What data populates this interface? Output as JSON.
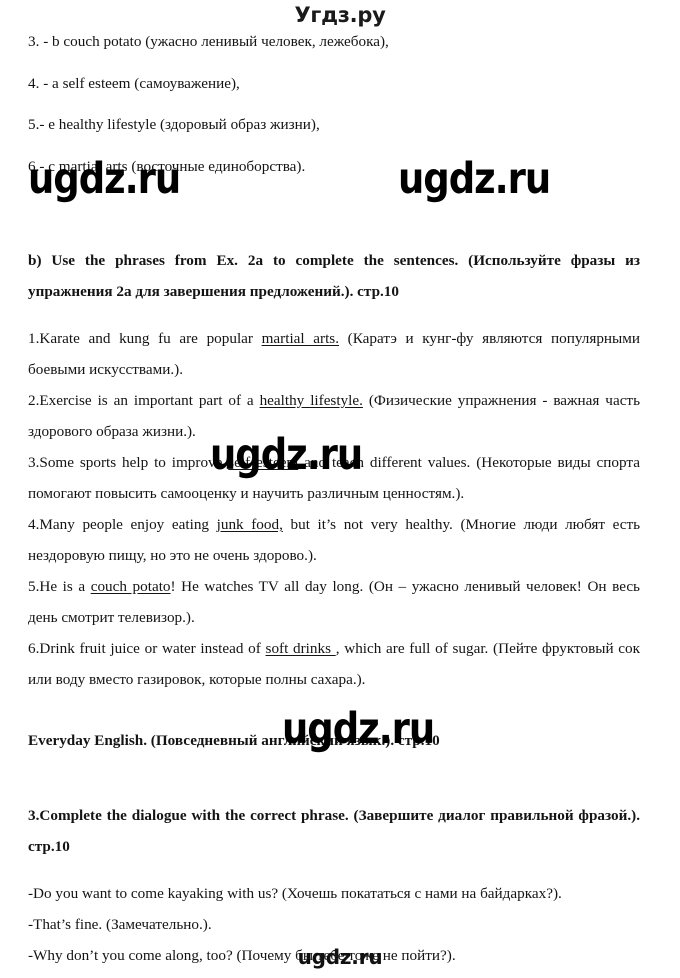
{
  "header": {
    "logo": "Угдз.ру"
  },
  "watermarks": {
    "text": "ugdz.ru",
    "footer_text": "ugdz.ru",
    "count": 4
  },
  "top_list": {
    "items": [
      "3. - b couch potato (ужасно ленивый человек, лежебока),",
      "4. - a self esteem (самоуважение),",
      "5.- e healthy lifestyle (здоровый образ жизни),",
      "6.- c martial arts (восточные единоборства)."
    ]
  },
  "exercise_b": {
    "heading_line1": "b) Use the phrases from Ex. 2a to complete the sentences. (Используйте фразы",
    "heading_line2": "из упражнения 2a для завершения предложений.). стр.10",
    "heading_full": "b) Use the phrases from Ex. 2a to complete the sentences. (Используйте фразы из упражнения 2a для завершения предложений.). стр.10",
    "sentences": [
      {
        "number": "1.",
        "before": "Karate and kung fu are popular ",
        "underlined": "martial arts.",
        "after": " (Каратэ и кунг-фу являются популярными боевыми искусствами.)."
      },
      {
        "number": "2.",
        "before": "Exercise is an important part of a ",
        "underlined": "healthy lifestyle.",
        "after": " (Физические упражнения - важная часть здорового образа жизни.)."
      },
      {
        "number": "3.",
        "before": "Some sports help to improve ",
        "underlined": "self esteem",
        "after": " and teach different values. (Некоторые виды спорта помогают повысить самооценку и научить различным ценностям.)."
      },
      {
        "number": "4.",
        "before": "Many people enjoy eating ",
        "underlined": "junk food,",
        "after": " but it’s not very healthy. (Многие люди любят есть нездоровую пищу, но это не очень здорово.)."
      },
      {
        "number": "5.",
        "before": "He is a ",
        "underlined": "couch potato",
        "after": "! He watches TV all day long. (Он – ужасно ленивый человек! Он весь день смотрит телевизор.)."
      },
      {
        "number": "6.",
        "before": "Drink fruit juice or water instead of ",
        "underlined": "soft drinks ",
        "after": ", which are full of sugar. (Пейте фруктовый сок или воду вместо газировок,  которые полны сахара.)."
      }
    ]
  },
  "everyday_english": {
    "heading": "Everyday English. (Повседневный английский язык.). стр.10"
  },
  "exercise_3": {
    "heading_line1": "3.Complete the dialogue with the correct phrase. (Завершите диалог",
    "heading_line2": "правильной фразой.). стр.10",
    "heading_full": "3.Complete the dialogue with the correct phrase. (Завершите диалог правильной фразой.). стр.10",
    "dialogue": [
      "-Do you want to come kayaking with us? (Хочешь покататься с нами на байдарках?).",
      "-That’s fine. (Замечательно.).",
      "-Why don’t you come along, too? (Почему бы тебе тоже не пойти?)."
    ]
  }
}
